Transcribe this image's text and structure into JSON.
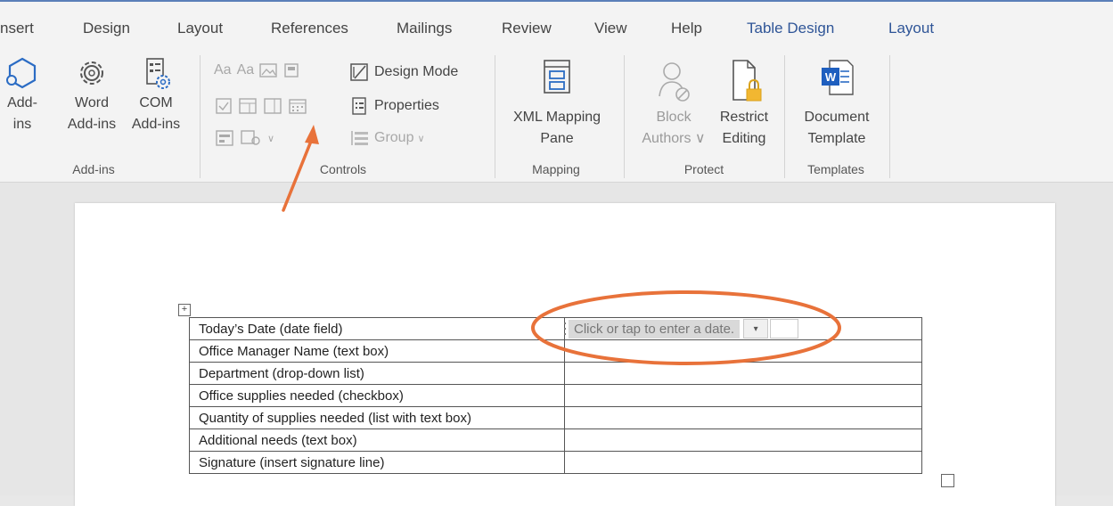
{
  "tabs": [
    "nsert",
    "Design",
    "Layout",
    "References",
    "Mailings",
    "Review",
    "View",
    "Help",
    "Table Design",
    "Layout"
  ],
  "ribbon": {
    "addins": {
      "group_label": "Add-ins",
      "addins_btn": {
        "l1": "Add-",
        "l2": "ins",
        "icon": "addins-hexagon-icon"
      },
      "word_addins_btn": {
        "l1": "Word",
        "l2": "Add-ins",
        "icon": "gear-icon"
      },
      "com_addins_btn": {
        "l1": "COM",
        "l2": "Add-ins",
        "icon": "com-addins-icon"
      }
    },
    "controls": {
      "group_label": "Controls",
      "design_mode": "Design Mode",
      "properties": "Properties",
      "group": "Group",
      "group_caret": "∨",
      "aa1": "Aa",
      "aa2": "Aa"
    },
    "mapping": {
      "group_label": "Mapping",
      "xml_btn": {
        "l1": "XML Mapping",
        "l2": "Pane"
      }
    },
    "protect": {
      "group_label": "Protect",
      "block_btn": {
        "l1": "Block",
        "l2": "Authors ∨"
      },
      "restrict_btn": {
        "l1": "Restrict",
        "l2": "Editing"
      }
    },
    "templates": {
      "group_label": "Templates",
      "doc_template_btn": {
        "l1": "Document",
        "l2": "Template",
        "icon_text": "W"
      }
    }
  },
  "table": {
    "rows": [
      "Today’s Date (date field)",
      "Office Manager Name (text box)",
      "Department (drop-down list)",
      "Office supplies needed (checkbox)",
      "Quantity of supplies needed (list with text box)",
      "Additional needs (text box)",
      "Signature (insert signature line)"
    ],
    "date_placeholder": "Click or tap to enter a date.",
    "dropdown_arrow": "▾",
    "move_handle": "+"
  },
  "colors": {
    "annotation": "#e8723a",
    "accent_tab": "#2f5597"
  }
}
